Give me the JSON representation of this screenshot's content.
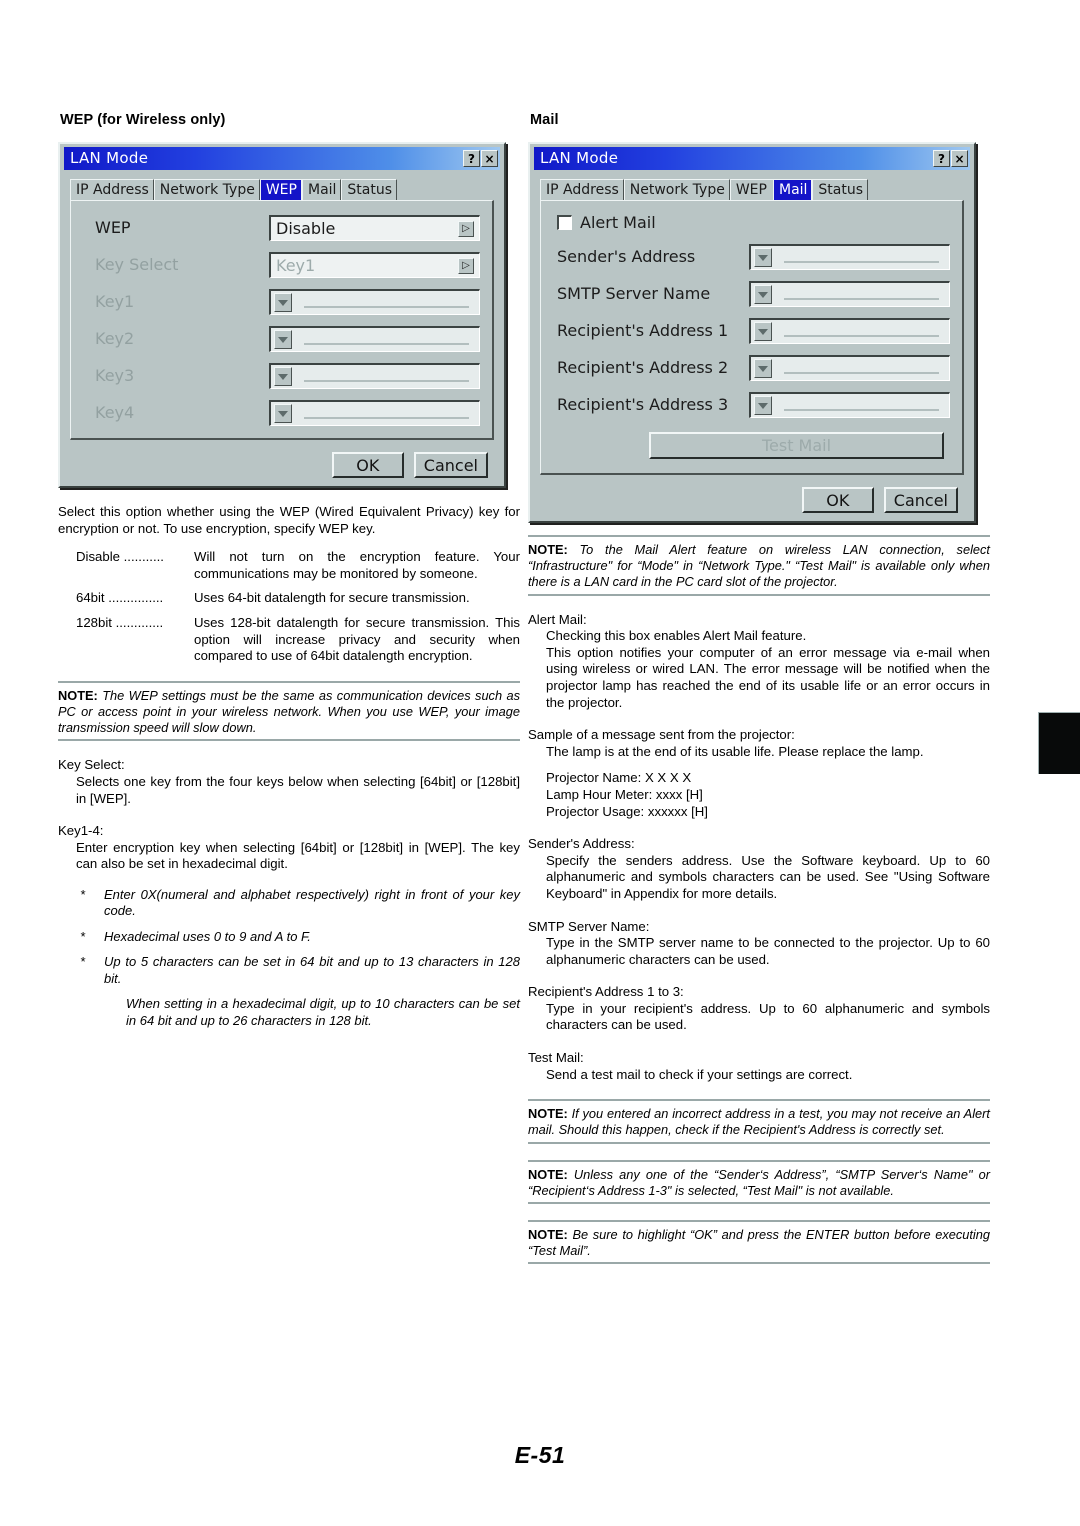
{
  "page": {
    "number": "E-51",
    "thumb_tab": "black-index-tab"
  },
  "left_column": {
    "section_title": "WEP (for Wireless only)",
    "dialog": {
      "title": "LAN Mode",
      "help_button": "?",
      "close_button": "×",
      "tabs": [
        {
          "label": "IP Address",
          "selected": false
        },
        {
          "label": "Network Type",
          "selected": false
        },
        {
          "label": "WEP",
          "selected": true
        },
        {
          "label": "Mail",
          "selected": false
        },
        {
          "label": "Status",
          "selected": false
        }
      ],
      "rows": [
        {
          "label": "WEP",
          "value": "Disable",
          "type": "combo",
          "disabled": false
        },
        {
          "label": "Key Select",
          "value": "Key1",
          "type": "combo",
          "disabled": true
        },
        {
          "label": "Key1",
          "value": "",
          "type": "keyfield",
          "disabled": true
        },
        {
          "label": "Key2",
          "value": "",
          "type": "keyfield",
          "disabled": true
        },
        {
          "label": "Key3",
          "value": "",
          "type": "keyfield",
          "disabled": true
        },
        {
          "label": "Key4",
          "value": "",
          "type": "keyfield",
          "disabled": true
        }
      ],
      "ok_label": "OK",
      "cancel_label": "Cancel"
    },
    "intro": "Select this option whether using the WEP (Wired Equivalent Privacy) key for encryption or not. To use encryption, specify WEP key.",
    "definitions": [
      {
        "term": "Disable ...........",
        "desc": "Will not turn on the encryption feature. Your communications may be monitored by someone."
      },
      {
        "term": "64bit ...............",
        "desc": "Uses 64-bit datalength for secure transmission."
      },
      {
        "term": "128bit .............",
        "desc": "Uses 128-bit datalength for secure transmission. This option will increase privacy and security when compared to use of 64bit datalength encryption."
      }
    ],
    "note1_label": "NOTE:",
    "note1_text": " The WEP settings must be the same as communication devices such as PC or access point in your wireless network. When you use WEP, your image transmission speed will slow down.",
    "key_select_heading": "Key Select:",
    "key_select_body": "Selects one key from the four keys below when selecting [64bit] or [128bit] in [WEP].",
    "key14_heading": "Key1-4:",
    "key14_body": "Enter encryption key when selecting [64bit] or [128bit] in [WEP]. The key can also be set in hexadecimal digit.",
    "star_marker": "*",
    "stars": [
      "Enter 0X(numeral and alphabet respectively) right in front of your key code.",
      "Hexadecimal uses 0 to 9 and A to F.",
      "Up to 5 characters can be set in 64 bit and up to 13 characters in 128 bit."
    ],
    "star_continuation": "When setting in a hexadecimal digit, up to 10 characters can be set in 64 bit and up to 26 characters in 128 bit."
  },
  "right_column": {
    "section_title": "Mail",
    "dialog": {
      "title": "LAN Mode",
      "help_button": "?",
      "close_button": "×",
      "tabs": [
        {
          "label": "IP Address",
          "selected": false
        },
        {
          "label": "Network Type",
          "selected": false
        },
        {
          "label": "WEP",
          "selected": false
        },
        {
          "label": "Mail",
          "selected": true
        },
        {
          "label": "Status",
          "selected": false
        }
      ],
      "checkbox_label": "Alert Mail",
      "checkbox_checked": false,
      "rows": [
        {
          "label": "Sender's Address",
          "value": ""
        },
        {
          "label": "SMTP Server Name",
          "value": ""
        },
        {
          "label": "Recipient's Address 1",
          "value": ""
        },
        {
          "label": "Recipient's Address 2",
          "value": ""
        },
        {
          "label": "Recipient's Address 3",
          "value": ""
        }
      ],
      "test_mail_label": "Test Mail",
      "test_mail_disabled": true,
      "ok_label": "OK",
      "cancel_label": "Cancel"
    },
    "note_top_label": "NOTE:",
    "note_top_text": " To the Mail Alert feature on wireless LAN connection, select “Infrastructure\" for “Mode\" in “Network Type.\" “Test Mail\" is available only when there is a LAN card in the PC card slot of the projector.",
    "alert_mail_heading": "Alert Mail:",
    "alert_mail_body1": "Checking this box enables Alert Mail feature.",
    "alert_mail_body2": "This option notifies your computer of an error message via e-mail when using wireless or wired LAN. The error message will be notified when the projector lamp has reached the end of its usable life or an error occurs in the projector.",
    "sample_heading": "Sample of a message sent from the projector:",
    "sample_body": "The lamp is at the end of its usable life. Please replace the lamp.",
    "sample_lines": [
      "Projector Name: X X X X",
      "Lamp Hour Meter: xxxx [H]",
      "Projector Usage: xxxxxx [H]"
    ],
    "sender_heading": "Sender's Address:",
    "sender_body": "Specify the senders address. Use the Software keyboard. Up to 60 alphanumeric and symbols characters can be used. See \"Using Software Keyboard\" in Appendix for more details.",
    "smtp_heading": "SMTP Server Name:",
    "smtp_body": "Type in the SMTP server name to be connected to the projector. Up to 60 alphanumeric characters can be used.",
    "recipient_heading": "Recipient's Address 1 to 3:",
    "recipient_body": "Type in your recipient's address. Up to 60 alphanumeric and symbols characters can be used.",
    "testmail_heading": "Test Mail:",
    "testmail_body": "Send a test mail to check if your settings are correct.",
    "note2_label": "NOTE:",
    "note2_text": " If you entered an incorrect address in a test, you may not receive an Alert mail. Should this happen, check if the Recipient's Address is correctly set.",
    "note3_label": "NOTE:",
    "note3_text": " Unless any one of the “Sender‘s Address”, “SMTP Server‘s Name\" or “Recipient‘s Address 1-3\" is selected, “Test Mail\" is not available.",
    "note4_label": "NOTE:",
    "note4_text": " Be sure to highlight “OK” and press the ENTER button before executing “Test Mail”."
  }
}
